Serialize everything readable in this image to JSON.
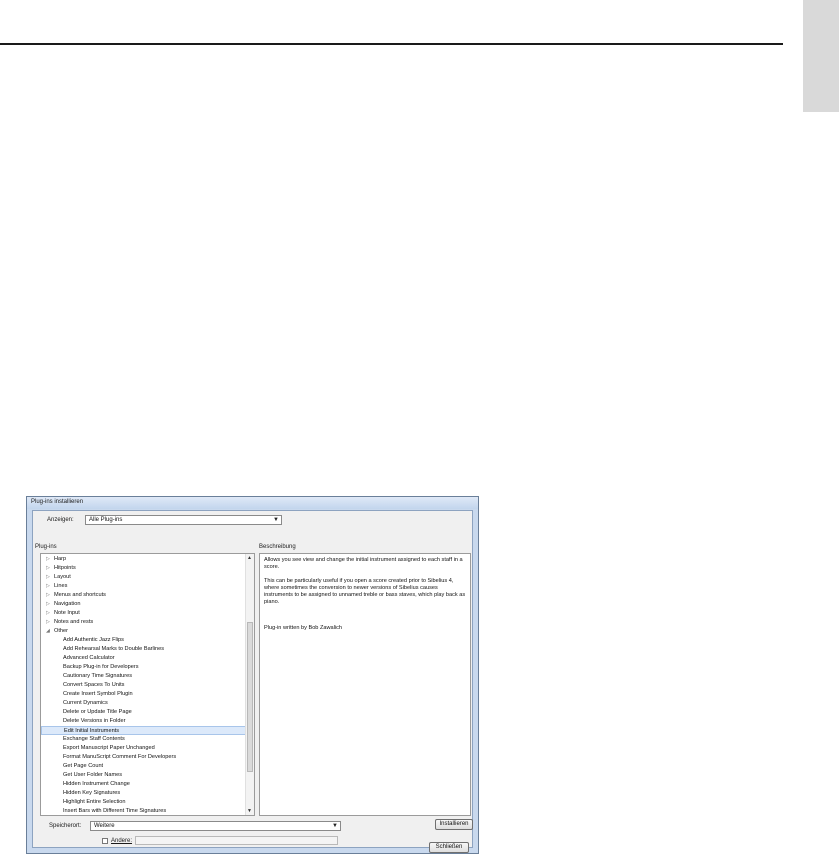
{
  "dialog": {
    "title": "Plug-ins installieren",
    "show_label": "Anzeigen:",
    "show_value": "Alle Plug-ins",
    "plugins_header": "Plug-ins",
    "description_header": "Beschreibung",
    "categories": [
      {
        "label": "Harp",
        "expanded": false
      },
      {
        "label": "Hitpoints",
        "expanded": false
      },
      {
        "label": "Layout",
        "expanded": false
      },
      {
        "label": "Lines",
        "expanded": false
      },
      {
        "label": "Menus and shortcuts",
        "expanded": false
      },
      {
        "label": "Navigation",
        "expanded": false
      },
      {
        "label": "Note Input",
        "expanded": false
      },
      {
        "label": "Notes and rests",
        "expanded": false
      },
      {
        "label": "Other",
        "expanded": true
      }
    ],
    "other_items": [
      "Add Authentic Jazz Flips",
      "Add Rehearsal Marks to Double Barlines",
      "Advanced Calculator",
      "Backup Plug-in for Developers",
      "Cautionary Time Signatures",
      "Convert Spaces To Units",
      "Create Insert Symbol Plugin",
      "Current Dynamics",
      "Delete or Update Title Page",
      "Delete Versions in Folder",
      "Edit Initial Instruments",
      "Exchange Staff Contents",
      "Export Manuscript Paper Unchanged",
      "Format ManuScript Comment For Developers",
      "Get Page Count",
      "Get User Folder Names",
      "Hidden Instrument Change",
      "Hidden Key Signatures",
      "Highlight Entire Selection",
      "Insert Bars with Different Time Signatures"
    ],
    "selected_item": "Edit Initial Instruments",
    "description": [
      "Allows you see view and change the initial instrument assigned to each staff in a score.",
      "This can be particularly useful if you open a score created prior to Sibelius 4, where sometimes the conversion to newer versions of Sibelius causes instruments to be assigned to unnamed treble or bass staves, which play back as piano.",
      "Plug-in written by Bob Zawalich"
    ],
    "location_label": "Speicherort:",
    "location_value": "Weitere",
    "install_button": "Installieren",
    "other_checkbox_label": "Andere:",
    "other_input_value": "",
    "close_button": "Schließen"
  },
  "icons": {
    "collapsed": "triangle-right-icon",
    "expanded": "triangle-down-icon",
    "dropdown": "chevron-down-icon"
  }
}
